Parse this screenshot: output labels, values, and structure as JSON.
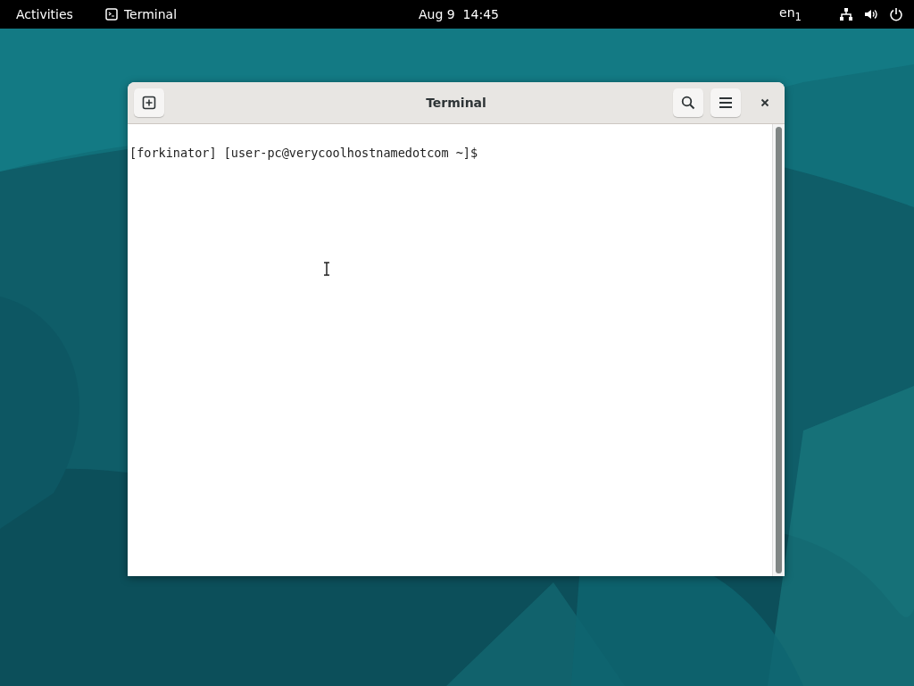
{
  "top_bar": {
    "activities": "Activities",
    "app_name": "Terminal",
    "clock": "Aug 9  14:45",
    "keyboard_layout": "en$_{1}$"
  },
  "window": {
    "title": "Terminal",
    "lines": [
      "[forkinator] [user-pc@verycoolhostnamedotcom ~]$"
    ]
  }
}
